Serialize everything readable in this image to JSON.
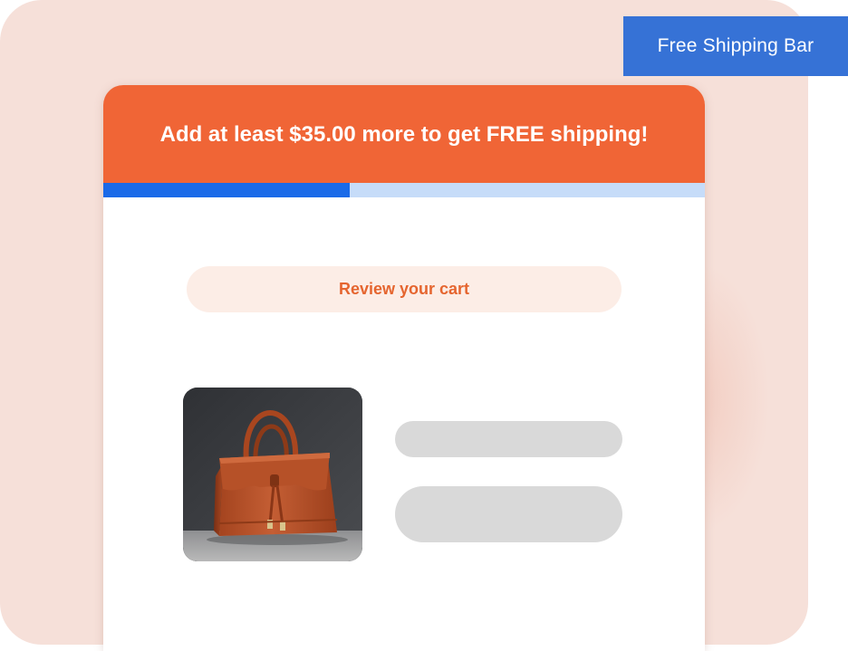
{
  "badge": {
    "label": "Free Shipping Bar"
  },
  "shipping_bar": {
    "message": "Add at least $35.00 more to get FREE shipping!",
    "progress_fraction": 0.41
  },
  "cart": {
    "review_label": "Review your cart",
    "product_image_icon": "handbag-image"
  },
  "colors": {
    "banner": "#f06536",
    "progress_fill": "#1a6ae8",
    "progress_track": "#c6dcf9",
    "badge": "#3672d6",
    "review_text": "#e5652f",
    "background": "#f6e0d9"
  }
}
